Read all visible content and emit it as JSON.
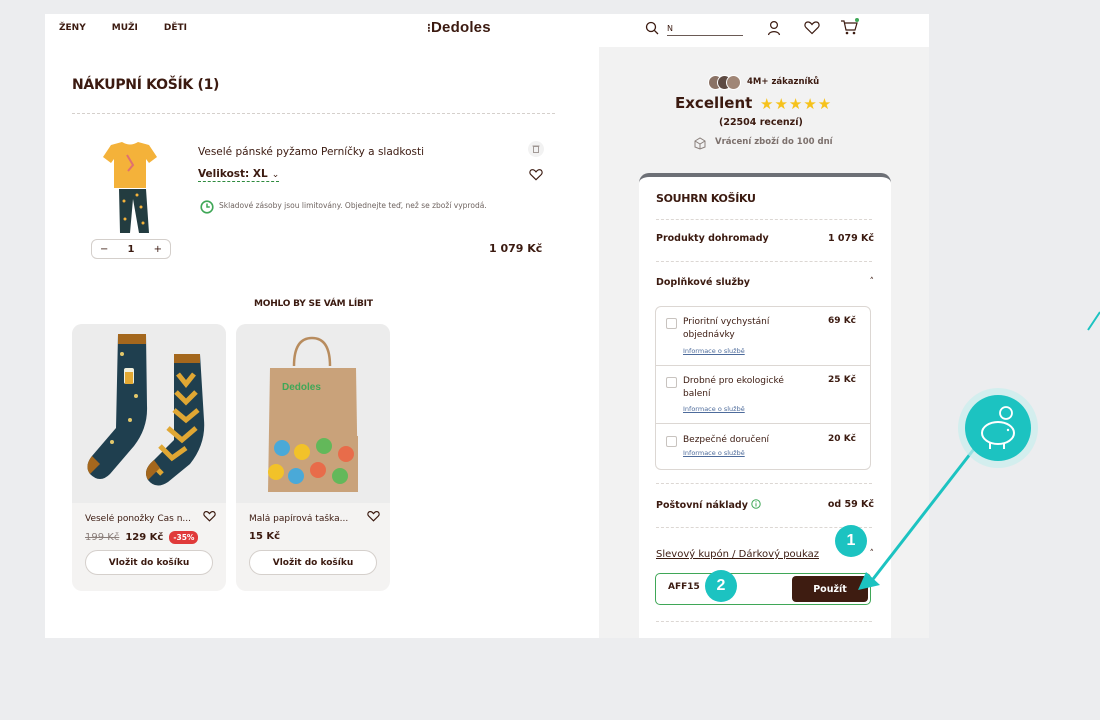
{
  "header": {
    "nav": [
      "ŽENY",
      "MUŽI",
      "DĚTI"
    ],
    "logo": "Dedoles",
    "search_value": "N"
  },
  "cart": {
    "title": "NÁKUPNÍ KOŠÍK (1)",
    "item": {
      "name": "Veselé pánské pyžamo Perníčky a sladkosti",
      "size_label": "Velikost: XL",
      "stock_note": "Skladové zásoby jsou limitovány. Objednejte teď, než se zboží vyprodá.",
      "quantity": "1",
      "minus": "−",
      "plus": "+",
      "price": "1 079 Kč"
    }
  },
  "recommendations": {
    "title": "MOHLO BY SE VÁM LÍBIT",
    "items": [
      {
        "name": "Veselé ponožky Čas n...",
        "old_price": "199 Kč",
        "price": "129 Kč",
        "discount": "-35%",
        "button": "Vložit do košíku"
      },
      {
        "name": "Malá papírová taška...",
        "old_price": "",
        "price": "15 Kč",
        "discount": "",
        "button": "Vložit do košíku"
      }
    ],
    "bag_brand": "Dedoles"
  },
  "trust": {
    "customers": "4M+ zákazníků",
    "rating_word": "Excellent",
    "stars": 5,
    "reviews": "(22504 recenzí)",
    "returns": "Vrácení zboží do 100 dní"
  },
  "summary": {
    "title": "SOUHRN KOŠÍKU",
    "products_label": "Produkty dohromady",
    "products_value": "1 079 Kč",
    "services_label": "Doplňkové služby",
    "services_chevron": "˄",
    "services": [
      {
        "name": "Prioritní vychystání objednávky",
        "price": "69 Kč",
        "info": "Informace o službě"
      },
      {
        "name": "Drobné pro ekologické balení",
        "price": "25 Kč",
        "info": "Informace o službě"
      },
      {
        "name": "Bezpečné doručení",
        "price": "20 Kč",
        "info": "Informace o službě"
      }
    ],
    "shipping_label": "Poštovní náklady",
    "shipping_value": "od 59 Kč",
    "coupon_label": "Slevový kupón / Dárkový poukaz",
    "coupon_value": "AFF15",
    "apply_button": "Použít"
  },
  "annotations": {
    "step1": "1",
    "step2": "2"
  },
  "colors": {
    "brown": "#3b1a10",
    "teal": "#1cc3c1",
    "green": "#3fa757",
    "star": "#f6c21b",
    "discount": "#e03a3a"
  }
}
